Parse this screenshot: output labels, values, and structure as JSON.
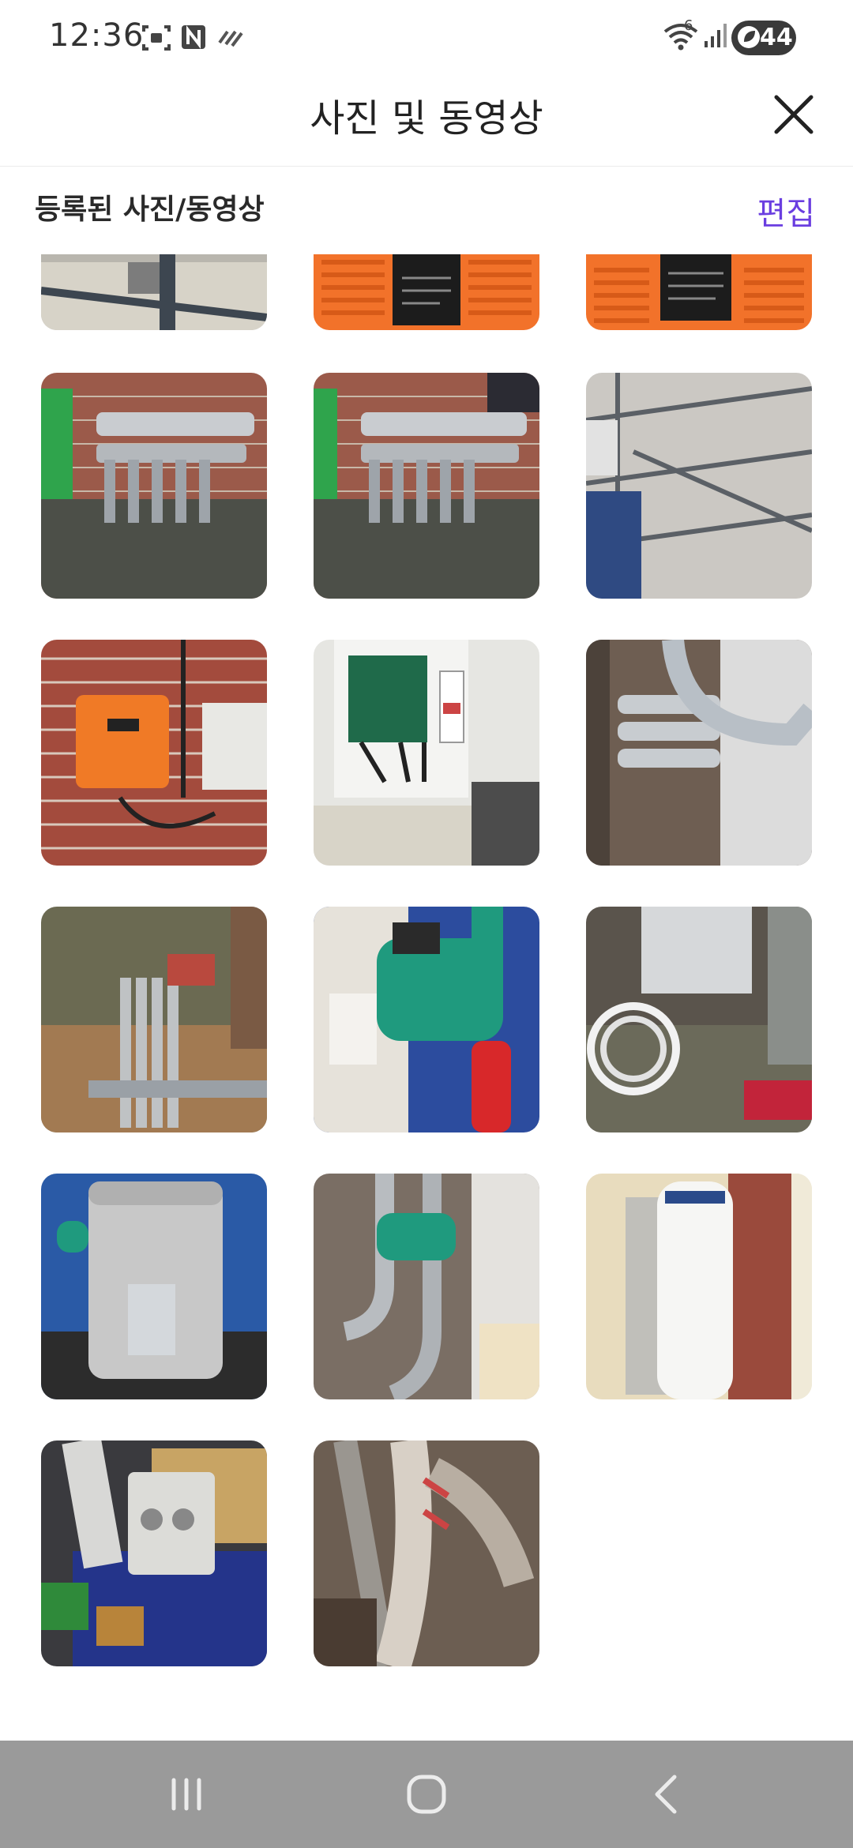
{
  "status_bar": {
    "time": "12:36",
    "left_icons": [
      "screenshot-icon",
      "n-app-icon",
      "data-saver-icon"
    ],
    "wifi_indicator": "6",
    "battery": "44"
  },
  "header": {
    "title": "사진 및 동영상",
    "close_icon": "close-icon"
  },
  "section": {
    "title": "등록된 사진/동영상",
    "edit_label": "편집",
    "accent_color": "#6a3ee0"
  },
  "photos": [
    {
      "subject": "wall-mounted pipe and frame"
    },
    {
      "subject": "orange inverter panel with warning label"
    },
    {
      "subject": "orange inverter panel with warning label"
    },
    {
      "subject": "manifold pipes on brick wall"
    },
    {
      "subject": "manifold pipes on brick wall"
    },
    {
      "subject": "solar panel frame underside"
    },
    {
      "subject": "orange controller on brick wall"
    },
    {
      "subject": "open electrical control box"
    },
    {
      "subject": "insulated pipes beside boiler"
    },
    {
      "subject": "stacked aluminum frames outdoors"
    },
    {
      "subject": "green circulation pump"
    },
    {
      "subject": "boiler unit with coiled hose"
    },
    {
      "subject": "insulated hot water tank"
    },
    {
      "subject": "pump and pipes in corner"
    },
    {
      "subject": "white water heater tank"
    },
    {
      "subject": "control box on workbench"
    },
    {
      "subject": "old insulated pipes"
    }
  ],
  "nav_bar": {
    "buttons": [
      "recent-apps-icon",
      "home-icon",
      "back-icon"
    ]
  }
}
